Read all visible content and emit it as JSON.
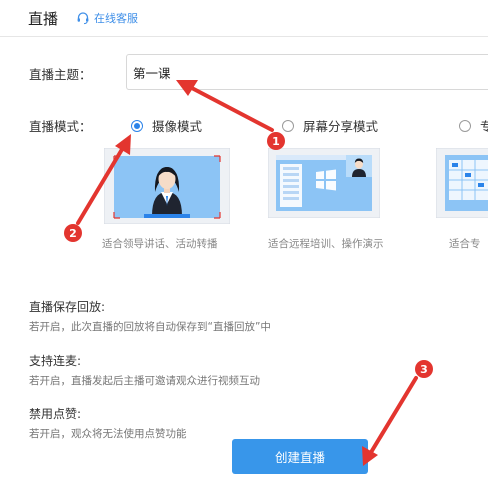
{
  "header": {
    "title": "直播",
    "support_label": "在线客服"
  },
  "form": {
    "topic_label": "直播主题：",
    "topic_value": "第一课",
    "mode_label": "直播模式："
  },
  "modes": [
    {
      "label": "摄像模式",
      "caption": "适合领导讲话、活动转播",
      "selected": true
    },
    {
      "label": "屏幕分享模式",
      "caption": "适合远程培训、操作演示",
      "selected": false
    },
    {
      "label": "专",
      "caption": "适合专",
      "selected": false
    }
  ],
  "settings": [
    {
      "title": "直播保存回放:",
      "desc": "若开启，此次直播的回放将自动保存到“直播回放”中"
    },
    {
      "title": "支持连麦:",
      "desc": "若开启，直播发起后主播可邀请观众进行视频互动"
    },
    {
      "title": "禁用点赞:",
      "desc": "若开启，观众将无法使用点赞功能"
    }
  ],
  "create_button": "创建直播",
  "annotations": {
    "badge_1": "1",
    "badge_2": "2",
    "badge_3": "3"
  },
  "colors": {
    "accent": "#3896ea",
    "annotation_red": "#e3352f",
    "thumb_blue": "#8cc4f5"
  }
}
